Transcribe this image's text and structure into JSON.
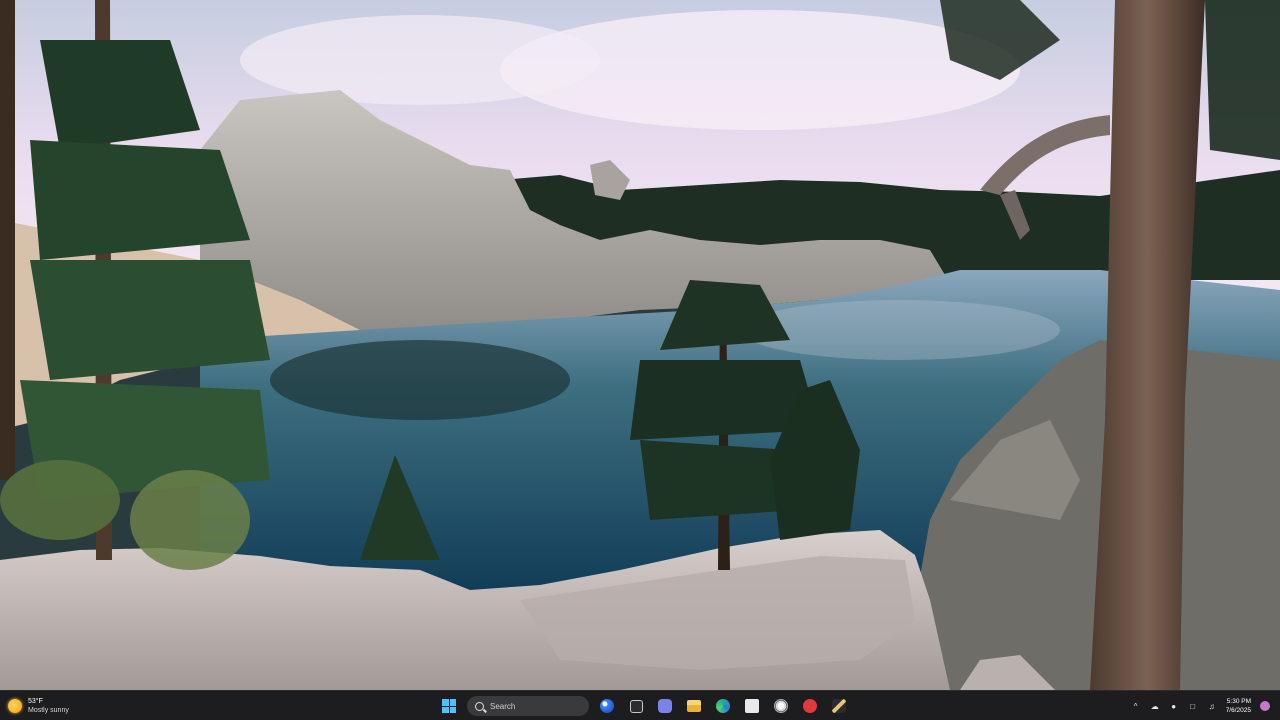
{
  "taskbar": {
    "weather": {
      "temperature": "53°F",
      "condition": "Mostly sunny",
      "icon": "sun-icon"
    },
    "search": {
      "placeholder": "Search"
    },
    "pinned_apps": [
      {
        "name": "copilot-icon",
        "color": "#3b82f6"
      },
      {
        "name": "task-view-icon",
        "color": "#c9c9c9"
      },
      {
        "name": "teams-icon",
        "color": "#7b83eb"
      },
      {
        "name": "file-explorer-icon",
        "color": "#f2c14e"
      },
      {
        "name": "edge-icon",
        "color": "#1fa9a0"
      },
      {
        "name": "microsoft-store-icon",
        "color": "#e9e9e9"
      },
      {
        "name": "chrome-icon",
        "color": "#d8d8d8"
      },
      {
        "name": "red-app-icon",
        "color": "#e03a3a"
      },
      {
        "name": "pen-app-icon",
        "color": "#e8c37a"
      }
    ],
    "tray": {
      "clock_time": "5:30 PM",
      "clock_date": "7/6/2025"
    }
  },
  "desktop": {
    "wallpaper": "lake-with-pines-and-granite-rocks"
  }
}
